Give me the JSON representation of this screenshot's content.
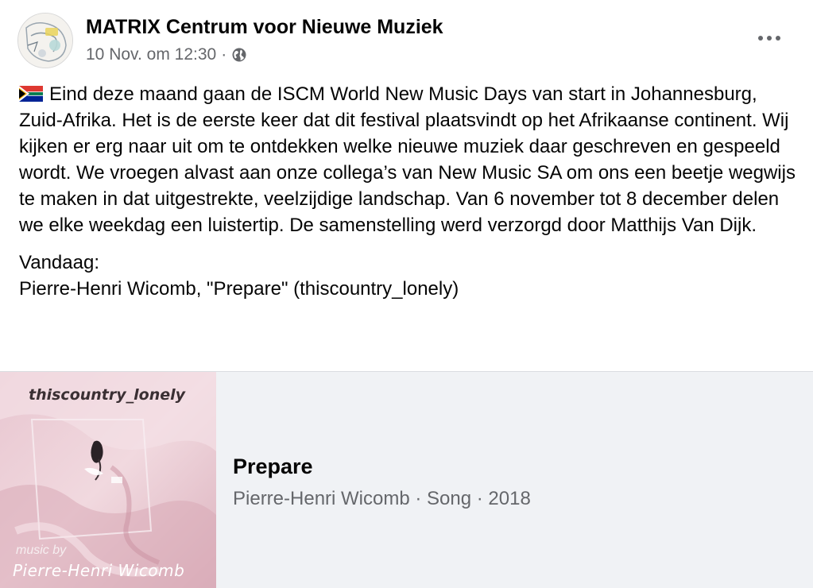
{
  "post": {
    "page_name": "MATRIX Centrum voor Nieuwe Muziek",
    "timestamp": "10 Nov. om 12:30",
    "separator": "·",
    "audience_icon": "globe-icon",
    "more_icon": "more-options-icon",
    "flag_icon": "south-africa-flag-icon",
    "body": "Eind deze maand gaan de ISCM World New Music Days van start in Johannesburg, Zuid-Afrika. Het is de eerste keer dat dit festival plaatsvindt op het Afrikaanse continent. Wij kijken er erg naar uit om te ontdekken welke nieuwe muziek daar geschreven en gespeeld wordt. We vroegen alvast aan onze collega’s van New Music SA om ons een beetje wegwijs te maken in dat uitgestrekte, veelzijdige landschap. Van 6 november tot 8 december delen we elke weekdag een luistertip. De samenstelling werd verzorgd door Matthijs Van Dijk.",
    "today_label": "Vandaag:",
    "today_item": "Pierre-Henri Wicomb, \"Prepare\" (thiscountry_lonely)"
  },
  "link_card": {
    "cover_title": "thiscountry_lonely",
    "cover_music_by": "music by",
    "cover_artist": "Pierre-Henri Wicomb",
    "title": "Prepare",
    "subtitle": "Pierre-Henri Wicomb · Song · 2018"
  },
  "colors": {
    "text_primary": "#050505",
    "text_secondary": "#65676b",
    "card_background": "#f0f2f5",
    "divider": "#dadde1"
  }
}
